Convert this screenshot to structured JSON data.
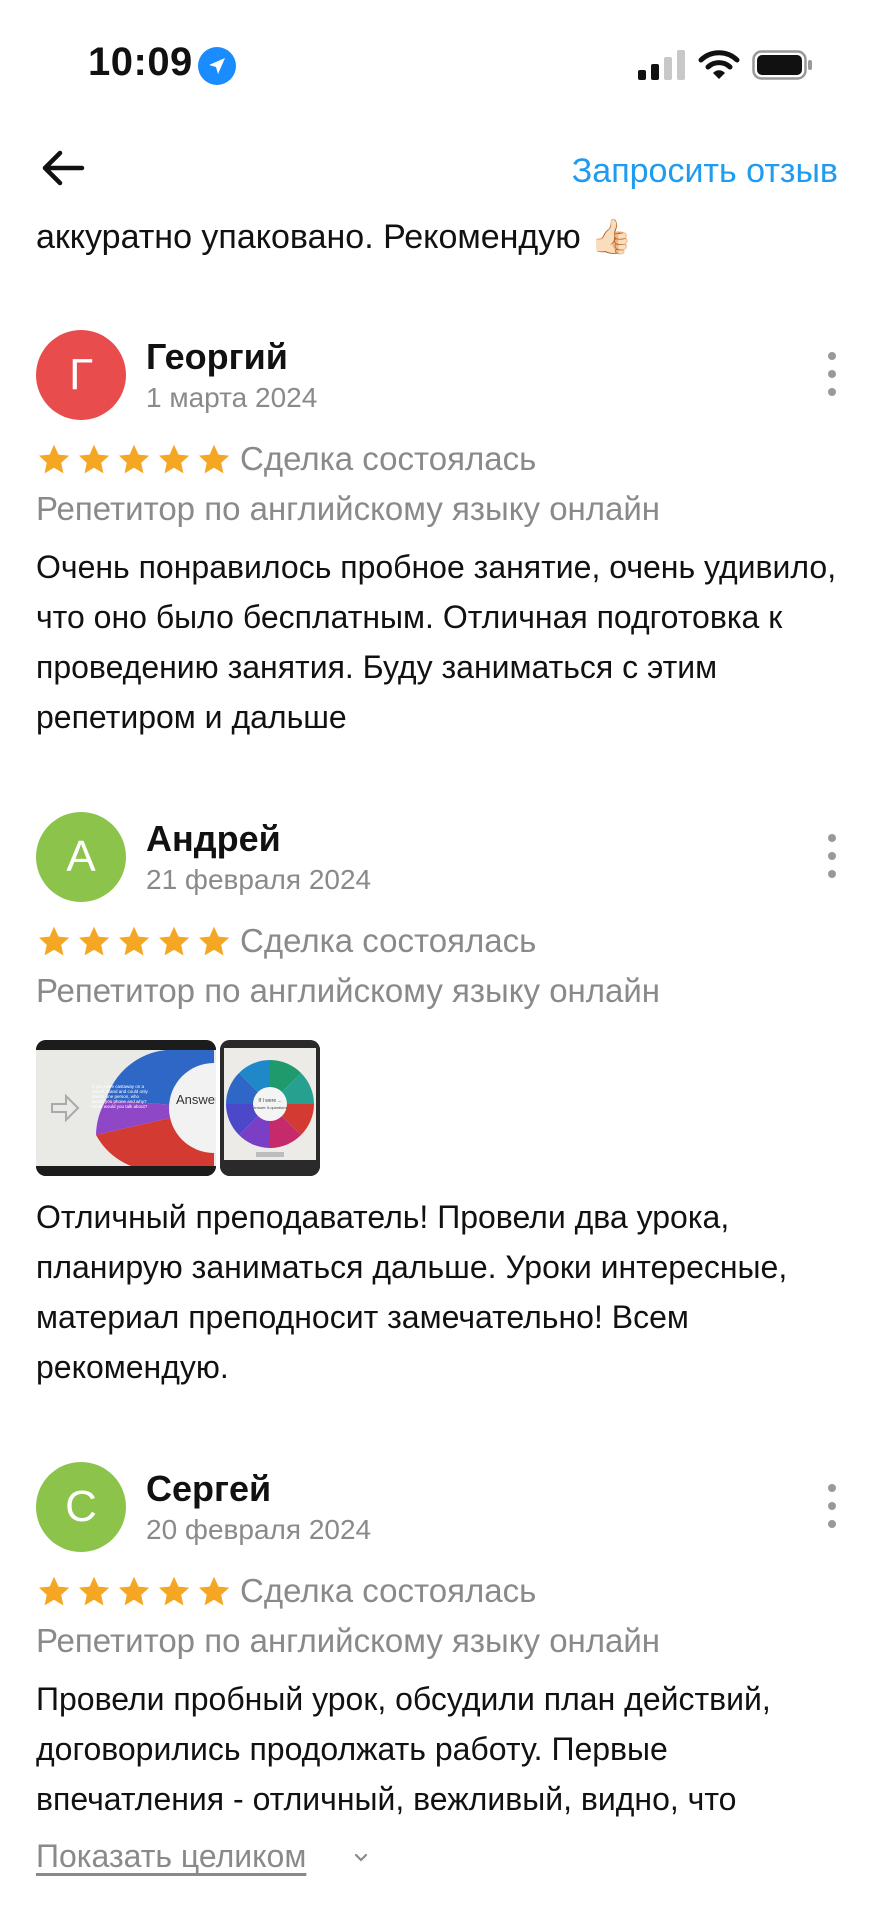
{
  "status_bar": {
    "time": "10:09"
  },
  "header": {
    "request_review_label": "Запросить отзыв"
  },
  "previous_review_tail": "аккуратно упаковано. Рекомендую 👍🏻",
  "reviews": [
    {
      "initial": "Г",
      "avatar_color": "#e84c4c",
      "name": "Георгий",
      "date": "1 марта 2024",
      "rating": 5,
      "status": "Сделка состоялась",
      "category": "Репетитор по английскому языку онлайн",
      "text": "Очень понравилось пробное занятие, очень удивило, что оно было бесплатным. Отличная подготовка к проведению занятия.  Буду заниматься с этим репетиром и дальше"
    },
    {
      "initial": "А",
      "avatar_color": "#8cc34a",
      "name": "Андрей",
      "date": "21 февраля 2024",
      "rating": 5,
      "status": "Сделка состоялась",
      "category": "Репетитор по английскому языку онлайн",
      "photo_texts": [
        "Answer if-questions",
        "If you were castaway on a desert island and could only phone one person, who would you phone and why? What would you talk about?",
        "If I were ...",
        "Answer if-questions"
      ],
      "text": "Отличный преподаватель! Провели два урока, планирую заниматься дальше. Уроки интересные, материал преподносит замечательно! Всем рекомендую."
    },
    {
      "initial": "С",
      "avatar_color": "#8cc34a",
      "name": "Сергей",
      "date": "20 февраля 2024",
      "rating": 5,
      "status": "Сделка состоялась",
      "category": "Репетитор по английскому языку онлайн",
      "text": "Провели пробный урок, обсудили план действий, договорились продолжать работу. Первые впечатления - отличный, вежливый, видно,  что",
      "show_more_label": "Показать целиком"
    }
  ],
  "colors": {
    "accent": "#1f9bf0",
    "star": "#f5a623",
    "muted": "#8a8a8a"
  }
}
